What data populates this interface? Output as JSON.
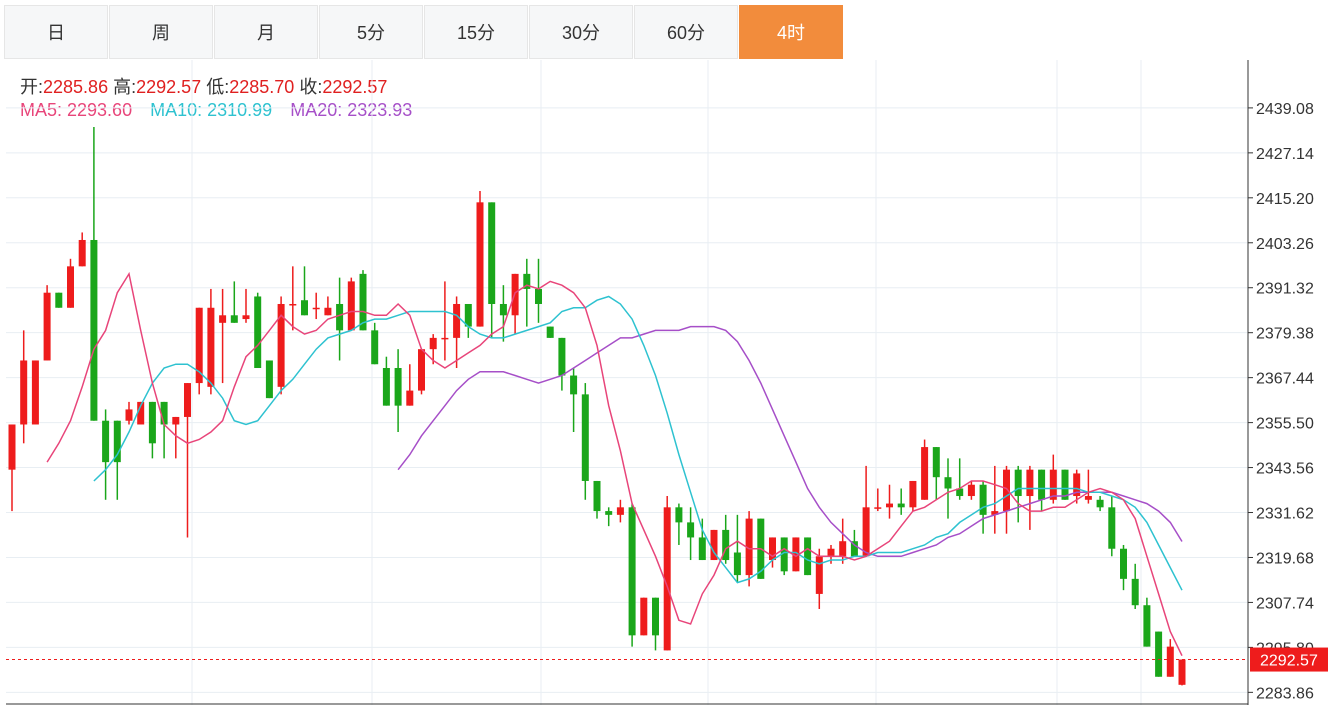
{
  "tabs": [
    {
      "label": "日",
      "active": false
    },
    {
      "label": "周",
      "active": false
    },
    {
      "label": "月",
      "active": false
    },
    {
      "label": "5分",
      "active": false
    },
    {
      "label": "15分",
      "active": false
    },
    {
      "label": "30分",
      "active": false
    },
    {
      "label": "60分",
      "active": false
    },
    {
      "label": "4时",
      "active": true
    }
  ],
  "ohlc_info": {
    "open_label": "开:",
    "open": "2285.86",
    "high_label": "高:",
    "high": "2292.57",
    "low_label": "低:",
    "low": "2285.70",
    "close_label": "收:",
    "close": "2292.57"
  },
  "ma_info": [
    {
      "label": "MA5:",
      "value": "2293.60",
      "color": "#e8457a"
    },
    {
      "label": "MA10:",
      "value": "2310.99",
      "color": "#2ec2d0"
    },
    {
      "label": "MA20:",
      "value": "2323.93",
      "color": "#a64fc8"
    }
  ],
  "colors": {
    "up": "#ee1c1c",
    "down": "#1aa61a",
    "grid": "#e8eef3",
    "ma5": "#e8457a",
    "ma10": "#2ec2d0",
    "ma20": "#a64fc8",
    "price_line": "#ee1c1c"
  },
  "chart_data": {
    "type": "candlestick",
    "y_ticks": [
      2283.86,
      2295.8,
      2307.74,
      2319.68,
      2331.62,
      2343.56,
      2355.5,
      2367.44,
      2379.38,
      2391.32,
      2403.26,
      2415.2,
      2427.14,
      2439.08
    ],
    "y_tick_labels": [
      "2283.86",
      "2295.80",
      "2307.74",
      "2319.68",
      "2331.62",
      "2343.56",
      "2355.50",
      "2367.44",
      "2379.38",
      "2391.32",
      "2403.26",
      "2415.20",
      "2427.14",
      "2439.08"
    ],
    "ylim": [
      2280.5,
      2451.8
    ],
    "current_price": 2292.57,
    "current_price_label": "2292.57",
    "candles": [
      [
        2343,
        2355,
        2332,
        2355
      ],
      [
        2355,
        2380,
        2350,
        2372
      ],
      [
        2355,
        2372,
        2355,
        2372
      ],
      [
        2372,
        2392,
        2372,
        2390
      ],
      [
        2390,
        2390,
        2386,
        2386
      ],
      [
        2386,
        2399,
        2386,
        2397
      ],
      [
        2397,
        2406,
        2397,
        2404
      ],
      [
        2404,
        2434,
        2356,
        2356
      ],
      [
        2356,
        2359,
        2335,
        2345
      ],
      [
        2356,
        2356,
        2335,
        2345
      ],
      [
        2356,
        2361,
        2355,
        2359
      ],
      [
        2355,
        2361,
        2355,
        2361
      ],
      [
        2361,
        2361,
        2346,
        2350
      ],
      [
        2361,
        2361,
        2346,
        2355
      ],
      [
        2355,
        2357,
        2346,
        2357
      ],
      [
        2357,
        2366,
        2325,
        2366
      ],
      [
        2366,
        2386,
        2363,
        2386
      ],
      [
        2365,
        2391,
        2363,
        2386
      ],
      [
        2382,
        2391,
        2366,
        2384
      ],
      [
        2384,
        2393,
        2382,
        2382
      ],
      [
        2383,
        2391,
        2382,
        2384
      ],
      [
        2389,
        2390,
        2370,
        2370
      ],
      [
        2372,
        2371,
        2368,
        2362
      ],
      [
        2365,
        2389,
        2363,
        2387
      ],
      [
        2387,
        2397,
        2380,
        2387
      ],
      [
        2388,
        2397,
        2385,
        2384
      ],
      [
        2386,
        2390,
        2383,
        2386
      ],
      [
        2384,
        2389,
        2384,
        2386
      ],
      [
        2387,
        2394,
        2372,
        2380
      ],
      [
        2380,
        2394,
        2380,
        2393
      ],
      [
        2395,
        2396,
        2385,
        2380
      ],
      [
        2380,
        2382,
        2375,
        2371
      ],
      [
        2370,
        2373,
        2363,
        2360
      ],
      [
        2370,
        2375,
        2353,
        2360
      ],
      [
        2360,
        2371,
        2360,
        2364
      ],
      [
        2364,
        2375,
        2363,
        2375
      ],
      [
        2375,
        2379,
        2371,
        2378
      ],
      [
        2378,
        2393,
        2372,
        2378
      ],
      [
        2378,
        2389,
        2370,
        2387
      ],
      [
        2387,
        2387,
        2378,
        2381
      ],
      [
        2381,
        2417,
        2381,
        2414
      ],
      [
        2414,
        2413,
        2378,
        2387
      ],
      [
        2387,
        2392,
        2377,
        2384
      ],
      [
        2384,
        2393,
        2379,
        2395
      ],
      [
        2395,
        2399,
        2381,
        2391
      ],
      [
        2391,
        2399,
        2382,
        2387
      ],
      [
        2381,
        2375,
        2378,
        2378
      ],
      [
        2378,
        2378,
        2364,
        2368
      ],
      [
        2368,
        2370,
        2353,
        2363
      ],
      [
        2363,
        2366,
        2335,
        2340
      ],
      [
        2340,
        2339,
        2330,
        2332
      ],
      [
        2332,
        2333,
        2328,
        2331
      ],
      [
        2331,
        2335,
        2329,
        2333
      ],
      [
        2333,
        2334,
        2296,
        2299
      ],
      [
        2299,
        2309,
        2300,
        2309
      ],
      [
        2309,
        2308,
        2295,
        2299
      ],
      [
        2295,
        2336,
        2295,
        2333
      ],
      [
        2333,
        2334,
        2323,
        2329
      ],
      [
        2329,
        2333,
        2319,
        2325
      ],
      [
        2325,
        2330,
        2320,
        2319
      ],
      [
        2319,
        2327,
        2319,
        2327
      ],
      [
        2327,
        2331,
        2318,
        2319
      ],
      [
        2321,
        2331,
        2313,
        2315
      ],
      [
        2315,
        2332,
        2312,
        2330
      ],
      [
        2330,
        2322,
        2316,
        2314
      ],
      [
        2319,
        2325,
        2317,
        2325
      ],
      [
        2325,
        2325,
        2315,
        2316
      ],
      [
        2316,
        2324,
        2316,
        2325
      ],
      [
        2325,
        2324,
        2322,
        2315
      ],
      [
        2310,
        2322,
        2306,
        2320
      ],
      [
        2320,
        2323,
        2318,
        2322
      ],
      [
        2320,
        2330,
        2318,
        2324
      ],
      [
        2324,
        2327,
        2320,
        2320
      ],
      [
        2320,
        2344,
        2320,
        2333
      ],
      [
        2333,
        2338,
        2332,
        2333
      ],
      [
        2333,
        2339,
        2330,
        2334
      ],
      [
        2334,
        2338,
        2331,
        2333
      ],
      [
        2333,
        2340,
        2332,
        2340
      ],
      [
        2335,
        2351,
        2335,
        2349
      ],
      [
        2349,
        2349,
        2335,
        2341
      ],
      [
        2341,
        2346,
        2330,
        2338
      ],
      [
        2338,
        2346,
        2335,
        2336
      ],
      [
        2336,
        2340,
        2335,
        2339
      ],
      [
        2339,
        2340,
        2326,
        2331
      ],
      [
        2331,
        2344,
        2326,
        2332
      ],
      [
        2332,
        2344,
        2326,
        2343
      ],
      [
        2343,
        2344,
        2329,
        2336
      ],
      [
        2336,
        2344,
        2327,
        2343
      ],
      [
        2343,
        2337,
        2332,
        2335
      ],
      [
        2335,
        2347,
        2334,
        2343
      ],
      [
        2343,
        2343,
        2336,
        2335
      ],
      [
        2336,
        2343,
        2334,
        2342
      ],
      [
        2335,
        2343,
        2334,
        2336
      ],
      [
        2335,
        2336,
        2332,
        2333
      ],
      [
        2333,
        2336,
        2320,
        2322
      ],
      [
        2322,
        2323,
        2311,
        2314
      ],
      [
        2314,
        2318,
        2306,
        2307
      ],
      [
        2307,
        2309,
        2296,
        2296
      ],
      [
        2300,
        2296,
        2288,
        2288
      ],
      [
        2288,
        2298,
        2288,
        2296
      ],
      [
        2285.86,
        2292.57,
        2285.7,
        2292.57
      ]
    ],
    "ma5": [
      2345,
      2350,
      2356,
      2365,
      2375,
      2380,
      2390,
      2395,
      2380,
      2366,
      2355,
      2352,
      2350,
      2351,
      2353,
      2356,
      2365,
      2373,
      2376,
      2380,
      2384,
      2381,
      2379,
      2380,
      2383,
      2384,
      2385,
      2385,
      2384,
      2384,
      2387,
      2384,
      2375,
      2372,
      2370,
      2372,
      2374,
      2376,
      2379,
      2381,
      2390,
      2392,
      2391,
      2393,
      2392,
      2390,
      2386,
      2376,
      2360,
      2348,
      2334,
      2327,
      2320,
      2312,
      2303,
      2302,
      2310,
      2315,
      2322,
      2324,
      2322,
      2322,
      2320,
      2322,
      2320,
      2322,
      2320,
      2320,
      2320,
      2319,
      2320,
      2322,
      2324,
      2328,
      2332,
      2333,
      2335,
      2337,
      2338,
      2340,
      2340,
      2339,
      2338,
      2334,
      2332,
      2332,
      2333,
      2333,
      2335,
      2337,
      2338,
      2337,
      2335,
      2330,
      2320,
      2310,
      2300,
      2293.6
    ],
    "ma10": [
      2340,
      2343,
      2347,
      2353,
      2360,
      2366,
      2370,
      2371,
      2371,
      2369,
      2366,
      2362,
      2356,
      2355,
      2356,
      2360,
      2364,
      2367,
      2371,
      2375,
      2378,
      2379,
      2380,
      2382,
      2383,
      2383,
      2384,
      2385,
      2385,
      2385,
      2385,
      2384,
      2381,
      2379,
      2378,
      2378,
      2379,
      2380,
      2381,
      2382,
      2385,
      2386,
      2386,
      2388,
      2389,
      2387,
      2383,
      2376,
      2368,
      2358,
      2347,
      2337,
      2327,
      2321,
      2317,
      2313,
      2314,
      2316,
      2319,
      2321,
      2321,
      2319,
      2318,
      2319,
      2319,
      2320,
      2320,
      2321,
      2321,
      2321,
      2322,
      2323,
      2325,
      2326,
      2329,
      2331,
      2333,
      2334,
      2336,
      2338,
      2338,
      2338,
      2338,
      2338,
      2338,
      2337,
      2337,
      2336,
      2335,
      2333,
      2329,
      2323,
      2317,
      2310.99
    ],
    "ma20": [
      2343,
      2347,
      2352,
      2356,
      2360,
      2364,
      2367,
      2369,
      2369,
      2369,
      2368,
      2367,
      2366,
      2367,
      2368,
      2370,
      2372,
      2374,
      2376,
      2378,
      2378,
      2379,
      2380,
      2380,
      2380,
      2381,
      2381,
      2381,
      2380,
      2377,
      2372,
      2366,
      2359,
      2352,
      2345,
      2338,
      2333,
      2329,
      2326,
      2323,
      2321,
      2320,
      2320,
      2320,
      2321,
      2322,
      2323,
      2325,
      2326,
      2328,
      2330,
      2331,
      2332,
      2333,
      2334,
      2335,
      2336,
      2336,
      2337,
      2337,
      2337,
      2337,
      2336,
      2335,
      2334,
      2332,
      2329,
      2323.93
    ]
  }
}
